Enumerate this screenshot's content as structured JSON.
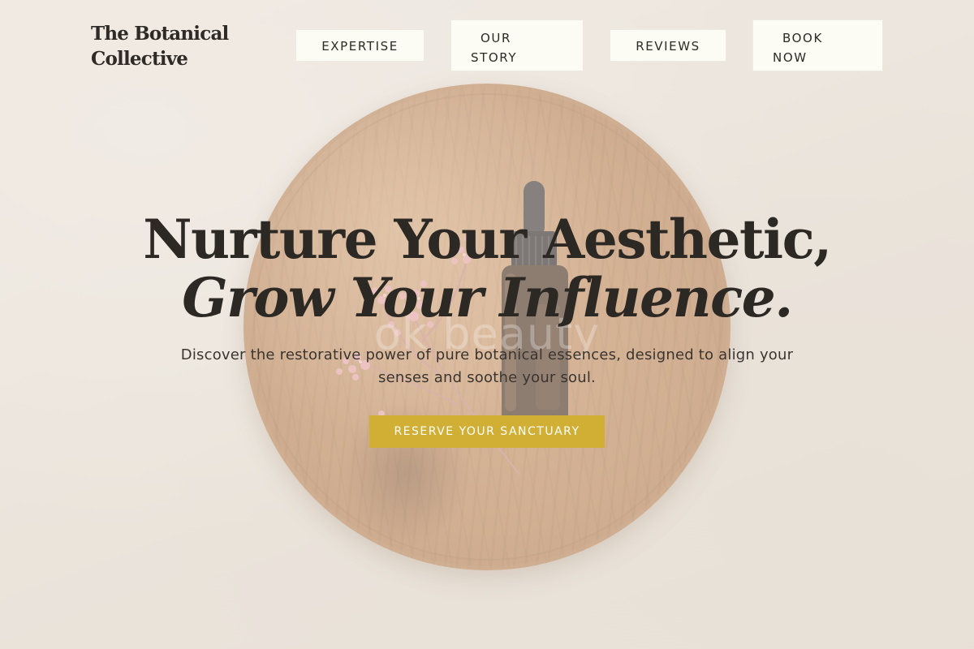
{
  "header": {
    "brand": "The Botanical Collective",
    "nav": {
      "expertise": "EXPERTISE",
      "story_line1": "OUR",
      "story_line2": "STORY",
      "reviews": "REVIEWS",
      "book_line1": "BOOK",
      "book_line2": "NOW"
    }
  },
  "hero": {
    "title_line1": "Nurture Your Aesthetic,",
    "title_line2": "Grow Your Influence.",
    "subtitle": "Discover the restorative power of pure botanical essences, designed to align your senses and soothe your soul.",
    "cta_label": "RESERVE YOUR SANCTUARY",
    "background_watermark": "ok beauty"
  },
  "colors": {
    "background": "#e9e2d9",
    "nav_button_bg": "#fcfbf4",
    "accent": "#d1af34",
    "text_dark": "#2c2824"
  },
  "icons": [
    "serum-bottle-image",
    "dried-flower-sprig-image",
    "wooden-plate-image"
  ]
}
